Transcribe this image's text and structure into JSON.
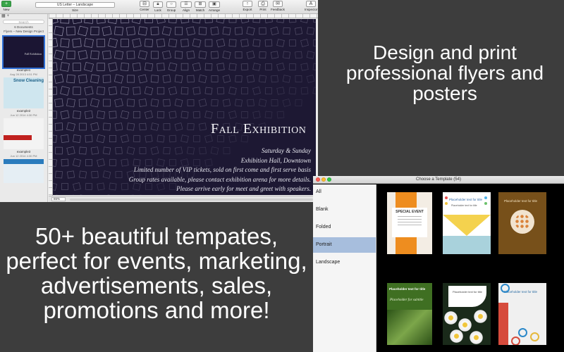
{
  "toolbar": {
    "new_label": "New",
    "size_select": "US Letter – Landscape",
    "size_label": "Size",
    "center_label": "Center",
    "lock_label": "Lock",
    "group_label": "Group",
    "align_label": "Align",
    "match_label": "Match",
    "arrange_label": "Arrange",
    "export_label": "Export",
    "print_label": "Print",
    "feedback_label": "Feedback",
    "inspector_label": "Inspector"
  },
  "sidebar": {
    "search_placeholder": "Search",
    "doc_count": "6 Documents",
    "project_name": "Flyers – New Design Project",
    "documents": [
      {
        "name": "example1",
        "date": "Aug 28 2013 4:51 PM"
      },
      {
        "name": "example2",
        "date": "Jun 12 2014 4:30 PM",
        "thumb_text": "Snow Cleaning"
      },
      {
        "name": "example3",
        "date": "Jun 12 2014 4:30 PM"
      },
      {
        "name": "example4",
        "date": "Jun 12 2014 4:30 PM"
      }
    ]
  },
  "flyer": {
    "title": "Fall Exhibition",
    "line1": "Saturday & Sunday",
    "line2": "Exhibition Hall, Downtown",
    "line3": "Limited number of VIP tickets, sold on first come and first serve basis",
    "line4": "Group rates available, please contact exhibition arena for more details.",
    "line5": "Please arrive early for meet and greet with speakers."
  },
  "statusbar": {
    "zoom": "65%"
  },
  "chooser": {
    "title": "Choose a Template (54)",
    "categories": [
      "All",
      "Blank",
      "Folded",
      "Portrait",
      "Landscape"
    ],
    "selected_category": "Portrait",
    "templates": [
      {
        "title": "SPECIAL EVENT"
      },
      {
        "title": "Placeholder text for title",
        "subtitle": "Placeholder text for title"
      },
      {
        "title": "Placeholder text for title"
      },
      {
        "title": "Placeholder text for title",
        "subtitle": "Placeholder for subtitle"
      },
      {
        "title": "Placeholder text for title"
      },
      {
        "title": "Placeholder text for title"
      }
    ]
  },
  "marketing": {
    "headline_1": "Design and print professional flyers and posters",
    "headline_2": "50+ beautiful tempates, perfect for events, marketing, advertisements, sales, promotions and more!"
  },
  "colors": {
    "background": "#3d3d3d",
    "flyer_background": "#1d1833",
    "selection": "#a7bedd"
  }
}
